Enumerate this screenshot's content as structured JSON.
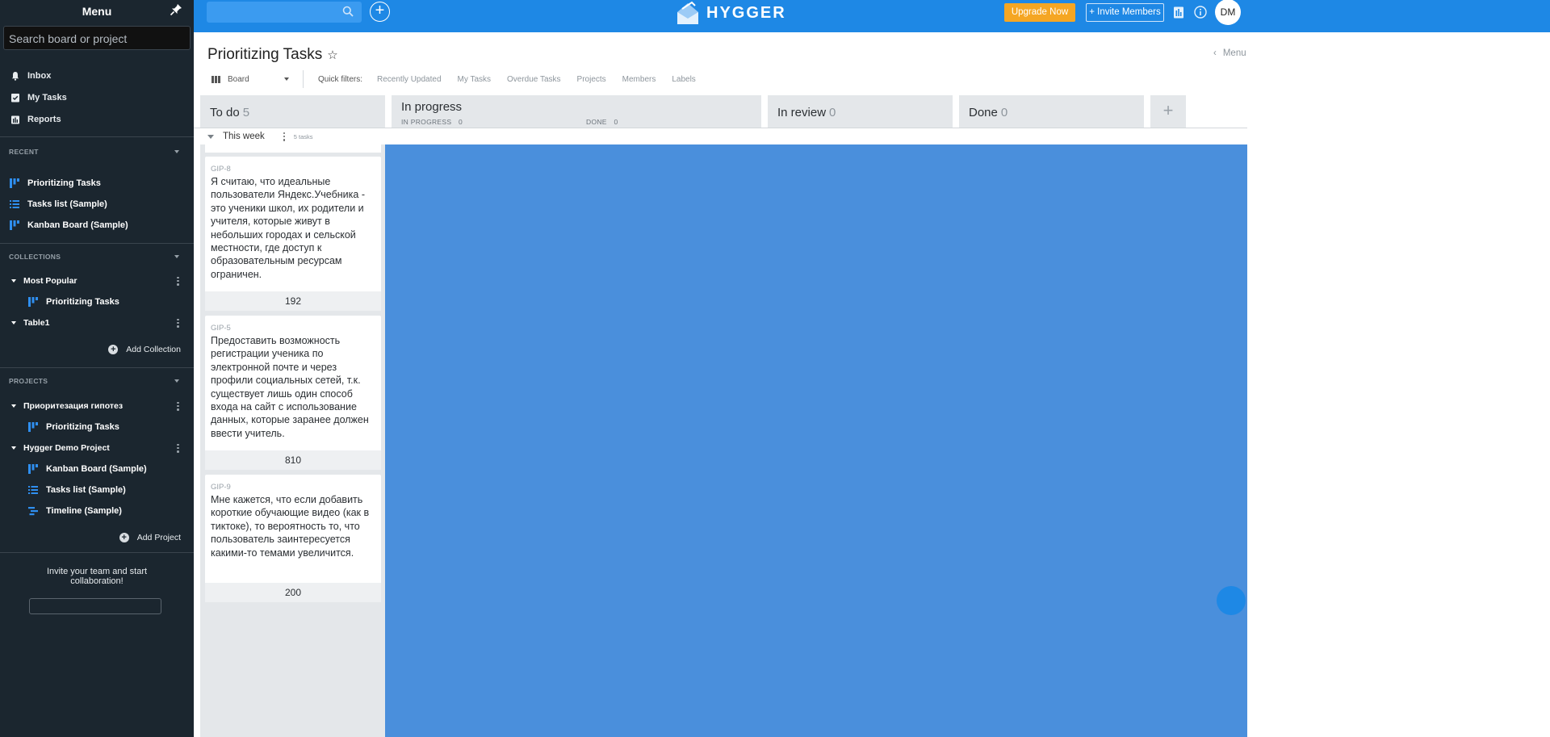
{
  "sidebar": {
    "title": "Menu",
    "search_placeholder": "Search board or project",
    "nav": [
      {
        "label": "Inbox",
        "icon": "bell-icon"
      },
      {
        "label": "My Tasks",
        "icon": "task-check-icon"
      },
      {
        "label": "Reports",
        "icon": "reports-icon"
      }
    ],
    "recent": {
      "header": "RECENT",
      "items": [
        {
          "label": "Prioritizing Tasks",
          "icon": "board-icon"
        },
        {
          "label": "Tasks list (Sample)",
          "icon": "list-icon"
        },
        {
          "label": "Kanban Board (Sample)",
          "icon": "board-icon"
        }
      ]
    },
    "collections": {
      "header": "COLLECTIONS",
      "groups": [
        {
          "label": "Most Popular",
          "items": [
            {
              "label": "Prioritizing Tasks",
              "icon": "board-icon"
            }
          ]
        },
        {
          "label": "Table1",
          "items": []
        }
      ],
      "add_label": "Add Collection"
    },
    "projects": {
      "header": "PROJECTS",
      "groups": [
        {
          "label": "Приоритезация гипотез",
          "items": [
            {
              "label": "Prioritizing Tasks",
              "icon": "board-icon"
            }
          ]
        },
        {
          "label": "Hygger Demo Project",
          "items": [
            {
              "label": "Kanban Board (Sample)",
              "icon": "board-icon"
            },
            {
              "label": "Tasks list (Sample)",
              "icon": "list-icon"
            },
            {
              "label": "Timeline (Sample)",
              "icon": "timeline-icon"
            }
          ]
        }
      ],
      "add_label": "Add Project"
    },
    "invite_text": "Invite your team and start collaboration!"
  },
  "topbar": {
    "logo_text": "HYGGER",
    "upgrade_label": "Upgrade Now",
    "invite_label": "+ Invite Members",
    "avatar_initials": "DM",
    "colors": {
      "bar": "#1e88e5",
      "upgrade": "#f5a623"
    }
  },
  "board": {
    "title": "Prioritizing Tasks",
    "menu_label": "Menu",
    "view_label": "Board",
    "quick_filters_label": "Quick filters:",
    "quick_filters": [
      "Recently Updated",
      "My Tasks",
      "Overdue Tasks",
      "Projects",
      "Members",
      "Labels"
    ],
    "columns": [
      {
        "title": "To do",
        "count": "5"
      },
      {
        "title": "In progress",
        "sub": [
          {
            "label": "IN PROGRESS",
            "count": "0"
          },
          {
            "label": "DONE",
            "count": "0"
          }
        ]
      },
      {
        "title": "In review",
        "count": "0"
      },
      {
        "title": "Done",
        "count": "0"
      }
    ],
    "swimlane": {
      "label": "This week",
      "count_label": "5 tasks"
    },
    "cards": [
      {
        "id": "GIP-8",
        "text": "Я считаю, что идеальные пользователи Яндекс.Учебника - это ученики школ, их родители и учителя, которые живут в небольших городах и сельской местности, где доступ к образовательным ресурсам ограничен.",
        "score": "192"
      },
      {
        "id": "GIP-5",
        "text": "Предоставить возможность регистрации ученика по электронной почте и через профили социальных сетей, т.к. существует лишь один способ входа на сайт с использование данных, которые заранее должен ввести учитель.",
        "score": "810"
      },
      {
        "id": "GIP-9",
        "text": "Мне кажется, что если добавить короткие обучающие видео (как в тиктоке), то вероятность то, что пользователь заинтересуется какими-то темами увеличится.",
        "score": "200"
      }
    ]
  }
}
